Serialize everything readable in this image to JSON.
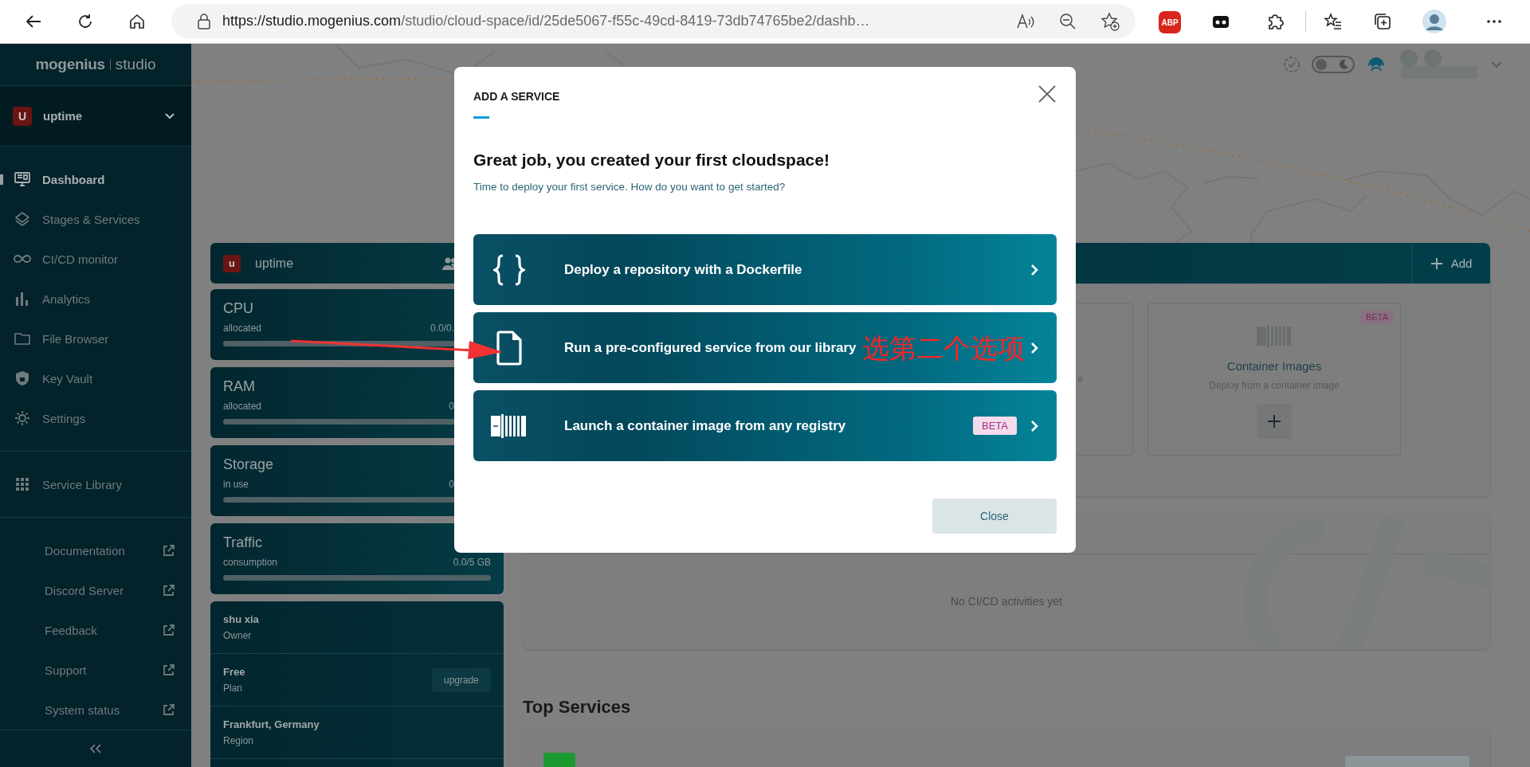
{
  "browser": {
    "url_host": "https://studio.mogenius.com",
    "url_path": "/studio/cloud-space/id/25de5067-f55c-49cd-8419-73db74765be2/dashb…",
    "extension_badge": "ABP"
  },
  "sidebar": {
    "brand": "mogenius",
    "product": "studio",
    "org": {
      "initial": "U",
      "name": "uptime"
    },
    "nav": [
      {
        "label": "Dashboard",
        "selected": true
      },
      {
        "label": "Stages & Services",
        "selected": false
      },
      {
        "label": "CI/CD monitor",
        "selected": false
      },
      {
        "label": "Analytics",
        "selected": false
      },
      {
        "label": "File Browser",
        "selected": false
      },
      {
        "label": "Key Vault",
        "selected": false
      },
      {
        "label": "Settings",
        "selected": false
      }
    ],
    "library": [
      {
        "label": "Service Library",
        "selected": false
      }
    ],
    "links": [
      {
        "label": "Documentation"
      },
      {
        "label": "Discord Server"
      },
      {
        "label": "Feedback"
      },
      {
        "label": "Support"
      },
      {
        "label": "System status"
      }
    ]
  },
  "header": {
    "theme_toggle": {
      "on": false
    }
  },
  "project": {
    "initial": "u",
    "name": "uptime"
  },
  "resources": [
    {
      "name": "CPU",
      "caption": "allocated",
      "reading": "0.0/0.",
      "level": 0
    },
    {
      "name": "RAM",
      "caption": "allocated",
      "reading": "0",
      "level": 0
    },
    {
      "name": "Storage",
      "caption": "in use",
      "reading": "0",
      "level": 0
    },
    {
      "name": "Traffic",
      "caption": "consumption",
      "reading": "0.0/5 GB",
      "level": 0
    }
  ],
  "account": [
    {
      "title": "shu xia",
      "caption": "Owner"
    },
    {
      "title": "Free",
      "caption": "Plan",
      "action": "upgrade"
    },
    {
      "title": "Frankfurt, Germany",
      "caption": "Region"
    }
  ],
  "services_panel": {
    "add_button": "Add",
    "cards": [
      {
        "kind": "partial",
        "description": "e"
      },
      {
        "kind": "container",
        "badge": "BETA",
        "title": "Container Images",
        "description": "Deploy from a container image"
      }
    ]
  },
  "activity_panel": {
    "empty_text": "No CI/CD activities yet"
  },
  "top_services": {
    "title": "Top Services"
  },
  "modal": {
    "title": "ADD A SERVICE",
    "heading": "Great job, you created your first cloudspace!",
    "subtitle": "Time to deploy your first service. How do you want to get started?",
    "options": [
      {
        "kind": "repository",
        "label": "Deploy a repository with a Dockerfile"
      },
      {
        "kind": "library",
        "label": "Run a pre-configured service from our library"
      },
      {
        "kind": "container",
        "label": "Launch a container image from any registry",
        "badge": "BETA"
      }
    ],
    "close_button": "Close"
  },
  "annotation": {
    "text": "选第二个选项"
  }
}
